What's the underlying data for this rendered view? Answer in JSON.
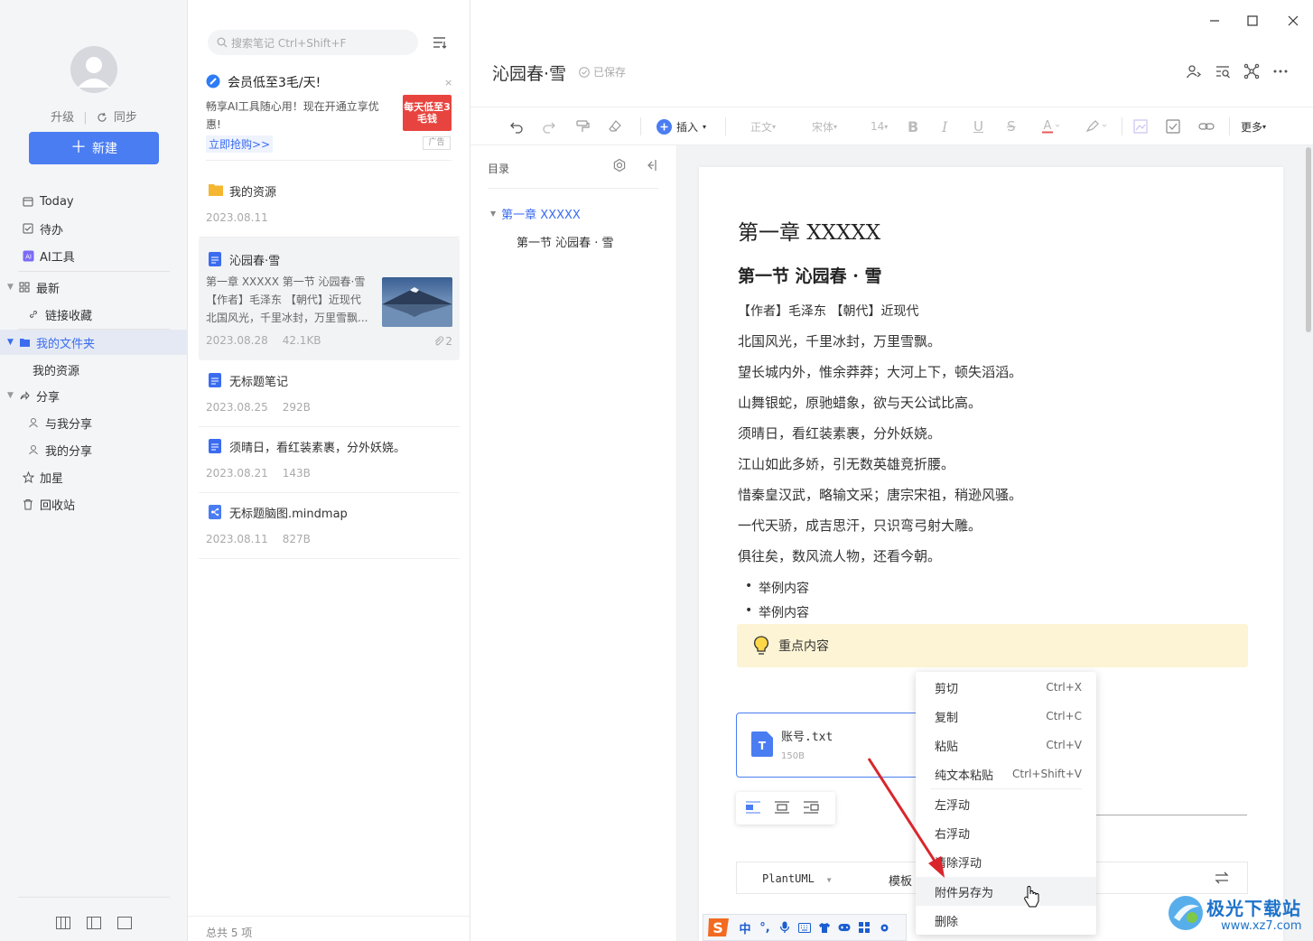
{
  "sidebar": {
    "upgrade": "升级",
    "sync": "同步",
    "new_label": "新建",
    "items": [
      {
        "label": "Today"
      },
      {
        "label": "待办"
      },
      {
        "label": "AI工具"
      },
      {
        "label": "最新"
      },
      {
        "label": "链接收藏"
      },
      {
        "label": "我的文件夹"
      },
      {
        "label": "我的资源"
      },
      {
        "label": "分享"
      },
      {
        "label": "与我分享"
      },
      {
        "label": "我的分享"
      },
      {
        "label": "加星"
      },
      {
        "label": "回收站"
      }
    ]
  },
  "list": {
    "search_placeholder": "搜索笔记 Ctrl+Shift+F",
    "promo": {
      "title": "会员低至3毛/天!",
      "body": "畅享AI工具随心用！现在开通立享优惠!",
      "link": "立即抢购>>",
      "badge": "每天低至3毛钱",
      "ad": "广告"
    },
    "notes": [
      {
        "title": "我的资源",
        "date": "2023.08.11",
        "size": ""
      },
      {
        "title": "沁园春·雪",
        "snippet": "第一章 XXXXX 第一节 沁园春·雪【作者】毛泽东 【朝代】近现代 北国风光，千里冰封，万里雪飘...",
        "date": "2023.08.28",
        "size": "42.1KB",
        "attachments": "2"
      },
      {
        "title": "无标题笔记",
        "date": "2023.08.25",
        "size": "292B"
      },
      {
        "title": "须晴日，看红装素裹，分外妖娆。",
        "date": "2023.08.21",
        "size": "143B"
      },
      {
        "title": "无标题脑图.mindmap",
        "date": "2023.08.11",
        "size": "827B"
      }
    ],
    "footer": "总共 5 项"
  },
  "editor": {
    "title": "沁园春·雪",
    "saved": "已保存",
    "toolbar": {
      "insert": "插入",
      "para": "正文",
      "font": "宋体",
      "size": "14",
      "more": "更多"
    },
    "outline": {
      "label": "目录",
      "items": [
        "第一章  XXXXX",
        "第一节 沁园春 · 雪"
      ]
    },
    "doc": {
      "h1": "第一章  XXXXX",
      "h2": "第一节  沁园春 · 雪",
      "meta": "【作者】毛泽东   【朝代】近现代",
      "lines": [
        "北国风光，千里冰封，万里雪飘。",
        "望长城内外，惟余莽莽；大河上下，顿失滔滔。",
        "山舞银蛇，原驰蜡象，欲与天公试比高。",
        "须晴日，看红装素裹，分外妖娆。",
        "江山如此多娇，引无数英雄竞折腰。",
        "惜秦皇汉武，略输文采；唐宗宋祖，稍逊风骚。",
        "一代天骄，成吉思汗，只识弯弓射大雕。",
        "俱往矣，数风流人物，还看今朝。"
      ],
      "bullets": [
        "举例内容",
        "举例内容"
      ],
      "callout": "重点内容",
      "attachment": {
        "name": "账号.txt",
        "size": "150B"
      },
      "plantuml": "PlantUML",
      "template": "模板"
    }
  },
  "context_menu": {
    "items": [
      {
        "label": "剪切",
        "shortcut": "Ctrl+X"
      },
      {
        "label": "复制",
        "shortcut": "Ctrl+C"
      },
      {
        "label": "粘贴",
        "shortcut": "Ctrl+V"
      },
      {
        "label": "纯文本粘贴",
        "shortcut": "Ctrl+Shift+V"
      },
      {
        "label": "左浮动",
        "shortcut": ""
      },
      {
        "label": "右浮动",
        "shortcut": ""
      },
      {
        "label": "清除浮动",
        "shortcut": ""
      },
      {
        "label": "附件另存为",
        "shortcut": ""
      },
      {
        "label": "删除",
        "shortcut": ""
      }
    ]
  },
  "ime": {
    "mode": "中"
  },
  "watermark": {
    "name": "极光下载站",
    "url": "www.xz7.com"
  },
  "colors": {
    "accent": "#4a7df2",
    "callout_bg": "#fdf4d5",
    "arrow": "#d9262c"
  }
}
